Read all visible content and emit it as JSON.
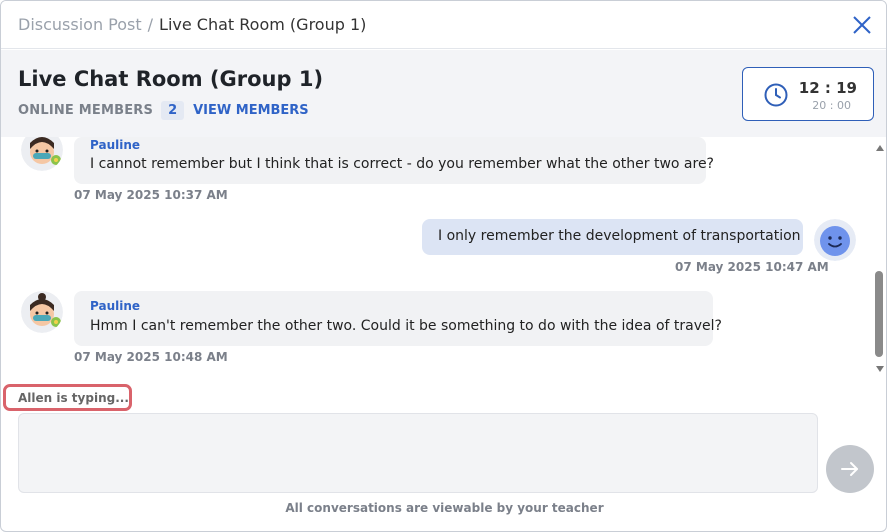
{
  "breadcrumb": {
    "parent": "Discussion Post",
    "separator": "/",
    "current": "Live Chat Room (Group 1)"
  },
  "header": {
    "title": "Live Chat Room (Group 1)",
    "online_members_label": "ONLINE MEMBERS",
    "online_members_count": "2",
    "view_members_label": "VIEW MEMBERS"
  },
  "timer": {
    "current": "12 : 19",
    "total": "20 : 00",
    "icon": "clock-icon"
  },
  "messages": [
    {
      "sender": "Pauline",
      "text": "I cannot remember but I think that is correct - do you remember what the other two are?",
      "timestamp": "07 May 2025 10:37 AM",
      "side": "left"
    },
    {
      "sender": "",
      "text": "I only remember the development of transportation",
      "timestamp": "07 May 2025 10:47 AM",
      "side": "right"
    },
    {
      "sender": "Pauline",
      "text": "Hmm I can't remember the other two. Could it be something to do with the idea of travel?",
      "timestamp": "07 May 2025 10:48 AM",
      "side": "left"
    }
  ],
  "typing_indicator": "Allen is typing...",
  "composer": {
    "placeholder": ""
  },
  "footer_note": "All conversations are viewable by your teacher",
  "colors": {
    "accent": "#2f63c7",
    "highlight": "#d9636b",
    "my_bubble": "#dce4f4",
    "other_bubble": "#f1f2f4"
  }
}
